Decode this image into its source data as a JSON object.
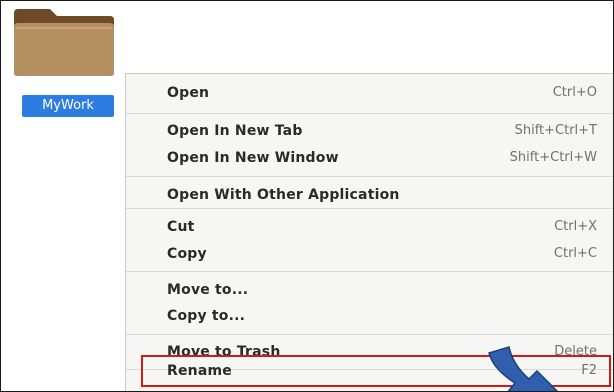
{
  "file": {
    "name": "MyWork"
  },
  "menu": {
    "items": [
      {
        "label": "Open",
        "shortcut": "Ctrl+O"
      },
      {
        "label": "Open In New Tab",
        "shortcut": "Shift+Ctrl+T"
      },
      {
        "label": "Open In New Window",
        "shortcut": "Shift+Ctrl+W"
      },
      {
        "label": "Open With Other Application",
        "shortcut": ""
      },
      {
        "label": "Cut",
        "shortcut": "Ctrl+X"
      },
      {
        "label": "Copy",
        "shortcut": "Ctrl+C"
      },
      {
        "label": "Move to...",
        "shortcut": ""
      },
      {
        "label": "Copy to...",
        "shortcut": ""
      },
      {
        "label": "Move to Trash",
        "shortcut": "Delete"
      },
      {
        "label": "Rename",
        "shortcut": "F2"
      }
    ]
  },
  "colors": {
    "folder": "#b48f61",
    "folder_tab": "#7a5633",
    "selection": "#2b7de1",
    "annotation_box": "#d11a1a",
    "annotation_arrow": "#2f5fae"
  },
  "icons": {
    "folder": "folder-icon",
    "arrow": "annotation-arrow-icon"
  }
}
